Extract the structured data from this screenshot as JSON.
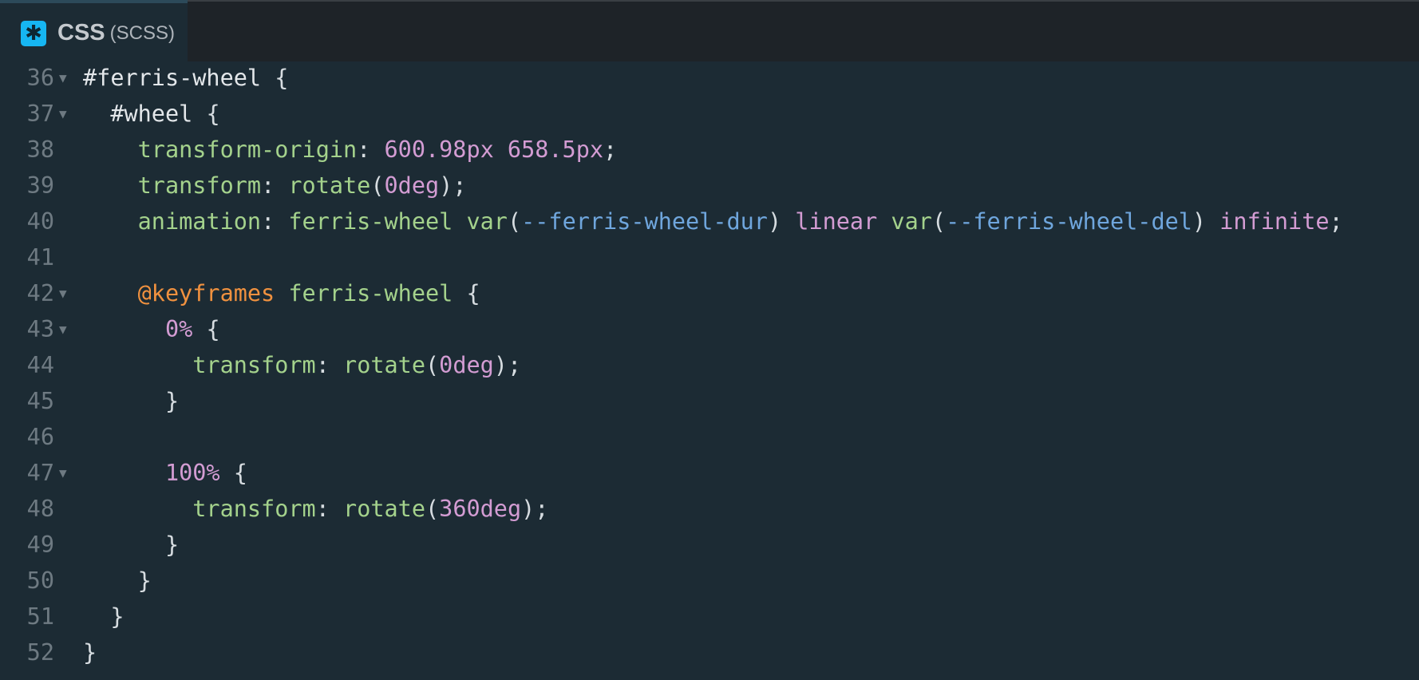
{
  "tab": {
    "icon": "✱",
    "title": "CSS",
    "subtitle": "(SCSS)"
  },
  "lines": [
    {
      "num": "36",
      "fold": true,
      "tokens": [
        [
          "sel",
          "#ferris-wheel "
        ],
        [
          "pun",
          "{"
        ]
      ]
    },
    {
      "num": "37",
      "fold": true,
      "tokens": [
        [
          "sel",
          "  #wheel "
        ],
        [
          "pun",
          "{"
        ]
      ]
    },
    {
      "num": "38",
      "fold": false,
      "tokens": [
        [
          "prop",
          "    transform-origin"
        ],
        [
          "pun",
          ": "
        ],
        [
          "num",
          "600.98px 658.5px"
        ],
        [
          "pun",
          ";"
        ]
      ]
    },
    {
      "num": "39",
      "fold": false,
      "tokens": [
        [
          "prop",
          "    transform"
        ],
        [
          "pun",
          ": "
        ],
        [
          "fn",
          "rotate"
        ],
        [
          "pun",
          "("
        ],
        [
          "num",
          "0deg"
        ],
        [
          "pun",
          ");"
        ]
      ]
    },
    {
      "num": "40",
      "fold": false,
      "tokens": [
        [
          "prop",
          "    animation"
        ],
        [
          "pun",
          ": "
        ],
        [
          "fn",
          "ferris-wheel var"
        ],
        [
          "pun",
          "("
        ],
        [
          "var",
          "--ferris-wheel-dur"
        ],
        [
          "pun",
          ") "
        ],
        [
          "kwv",
          "linear "
        ],
        [
          "fn",
          "var"
        ],
        [
          "pun",
          "("
        ],
        [
          "var",
          "--ferris-wheel-del"
        ],
        [
          "pun",
          ") "
        ],
        [
          "kwv",
          "infinite"
        ],
        [
          "pun",
          ";"
        ]
      ]
    },
    {
      "num": "41",
      "fold": false,
      "tokens": []
    },
    {
      "num": "42",
      "fold": true,
      "tokens": [
        [
          "kw",
          "    @keyframes "
        ],
        [
          "fn",
          "ferris-wheel "
        ],
        [
          "pun",
          "{"
        ]
      ]
    },
    {
      "num": "43",
      "fold": true,
      "tokens": [
        [
          "num",
          "      0% "
        ],
        [
          "pun",
          "{"
        ]
      ]
    },
    {
      "num": "44",
      "fold": false,
      "tokens": [
        [
          "prop",
          "        transform"
        ],
        [
          "pun",
          ": "
        ],
        [
          "fn",
          "rotate"
        ],
        [
          "pun",
          "("
        ],
        [
          "num",
          "0deg"
        ],
        [
          "pun",
          ");"
        ]
      ]
    },
    {
      "num": "45",
      "fold": false,
      "tokens": [
        [
          "pun",
          "      }"
        ]
      ]
    },
    {
      "num": "46",
      "fold": false,
      "tokens": []
    },
    {
      "num": "47",
      "fold": true,
      "tokens": [
        [
          "num",
          "      100% "
        ],
        [
          "pun",
          "{"
        ]
      ]
    },
    {
      "num": "48",
      "fold": false,
      "tokens": [
        [
          "prop",
          "        transform"
        ],
        [
          "pun",
          ": "
        ],
        [
          "fn",
          "rotate"
        ],
        [
          "pun",
          "("
        ],
        [
          "num",
          "360deg"
        ],
        [
          "pun",
          ");"
        ]
      ]
    },
    {
      "num": "49",
      "fold": false,
      "tokens": [
        [
          "pun",
          "      }"
        ]
      ]
    },
    {
      "num": "50",
      "fold": false,
      "tokens": [
        [
          "pun",
          "    }"
        ]
      ]
    },
    {
      "num": "51",
      "fold": false,
      "tokens": [
        [
          "pun",
          "  }"
        ]
      ]
    },
    {
      "num": "52",
      "fold": false,
      "tokens": [
        [
          "pun",
          "}"
        ]
      ]
    }
  ],
  "colors": {
    "background": "#1c2b34",
    "selector": "#e3e7ea",
    "property": "#a4d28c",
    "number": "#d39cd3",
    "variable": "#6fa6dd",
    "at_rule": "#f0913f",
    "line_number": "#6e7a82",
    "tab_icon": "#16b6f2"
  }
}
